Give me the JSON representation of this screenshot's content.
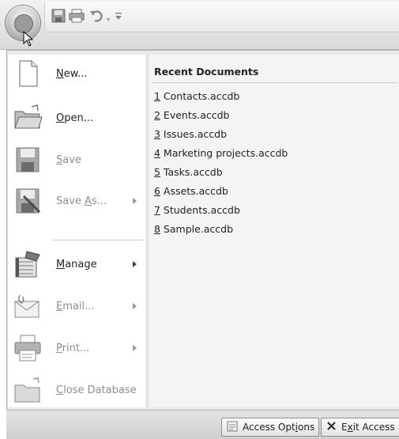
{
  "file_menu": {
    "items": [
      {
        "id": "new",
        "pre": "",
        "key": "N",
        "post": "ew...",
        "disabled": false,
        "submenu": false,
        "icon": "new-document-icon"
      },
      {
        "id": "open",
        "pre": "",
        "key": "O",
        "post": "pen...",
        "disabled": false,
        "submenu": false,
        "icon": "open-folder-icon"
      },
      {
        "id": "save",
        "pre": "",
        "key": "S",
        "post": "ave",
        "disabled": true,
        "submenu": false,
        "icon": "save-disk-icon"
      },
      {
        "id": "save-as",
        "pre": "Save ",
        "key": "A",
        "post": "s...",
        "disabled": true,
        "submenu": true,
        "icon": "save-as-icon"
      },
      {
        "id": "manage",
        "pre": "",
        "key": "M",
        "post": "anage",
        "disabled": false,
        "submenu": true,
        "icon": "manage-database-icon"
      },
      {
        "id": "email",
        "pre": "",
        "key": "E",
        "post": "mail...",
        "disabled": true,
        "submenu": true,
        "icon": "email-icon"
      },
      {
        "id": "print",
        "pre": "",
        "key": "P",
        "post": "rint...",
        "disabled": true,
        "submenu": true,
        "icon": "printer-icon"
      },
      {
        "id": "close-database",
        "pre": "",
        "key": "C",
        "post": "lose Database",
        "disabled": true,
        "submenu": false,
        "icon": "close-database-icon"
      }
    ]
  },
  "recent": {
    "title": "Recent Documents",
    "documents": [
      {
        "num": "1",
        "name": " Contacts.accdb"
      },
      {
        "num": "2",
        "name": " Events.accdb"
      },
      {
        "num": "3",
        "name": " Issues.accdb"
      },
      {
        "num": "4",
        "name": " Marketing projects.accdb"
      },
      {
        "num": "5",
        "name": " Tasks.accdb"
      },
      {
        "num": "6",
        "name": " Assets.accdb"
      },
      {
        "num": "7",
        "name": " Students.accdb"
      },
      {
        "num": "8",
        "name": " Sample.accdb"
      }
    ]
  },
  "bottom": {
    "options": {
      "pre": "Access Opt",
      "key": "i",
      "post": "ons"
    },
    "exit": {
      "pre": "E",
      "key": "x",
      "post": "it Access"
    }
  },
  "icons": {
    "office_button": "office-button-icon",
    "qat": [
      "save-icon",
      "print-icon",
      "undo-icon",
      "customize-dropdown-icon"
    ]
  }
}
